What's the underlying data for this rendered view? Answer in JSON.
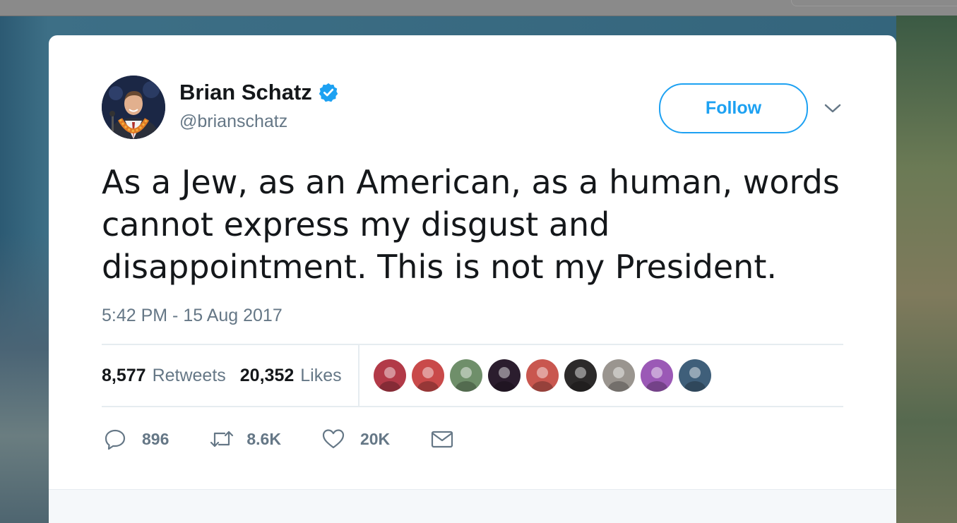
{
  "tweet": {
    "author_name": "Brian Schatz",
    "handle": "@brianschatz",
    "follow_label": "Follow",
    "text": "As a Jew, as an American, as a human, words cannot express my disgust and disappointment. This is not my President.",
    "timestamp": "5:42 PM - 15 Aug 2017",
    "stats": {
      "retweets_count": "8,577",
      "retweets_label": "Retweets",
      "likes_count": "20,352",
      "likes_label": "Likes"
    },
    "actions": {
      "replies": "896",
      "retweets": "8.6K",
      "likes": "20K"
    }
  },
  "icons": {
    "verified": "verified-badge-icon",
    "caret": "chevron-down-icon",
    "reply": "reply-icon",
    "retweet": "retweet-icon",
    "like": "heart-icon",
    "dm": "envelope-icon"
  },
  "colors": {
    "accent": "#1da1f2",
    "text_primary": "#14171a",
    "text_secondary": "#657786",
    "divider": "#e6ecf0"
  },
  "liker_avatar_colors": [
    "#b23a48",
    "#c94a4a",
    "#6f8f6a",
    "#2b1d2e",
    "#c9574f",
    "#2c2a2a",
    "#9a958f",
    "#9b59b6",
    "#3f5f7a"
  ]
}
